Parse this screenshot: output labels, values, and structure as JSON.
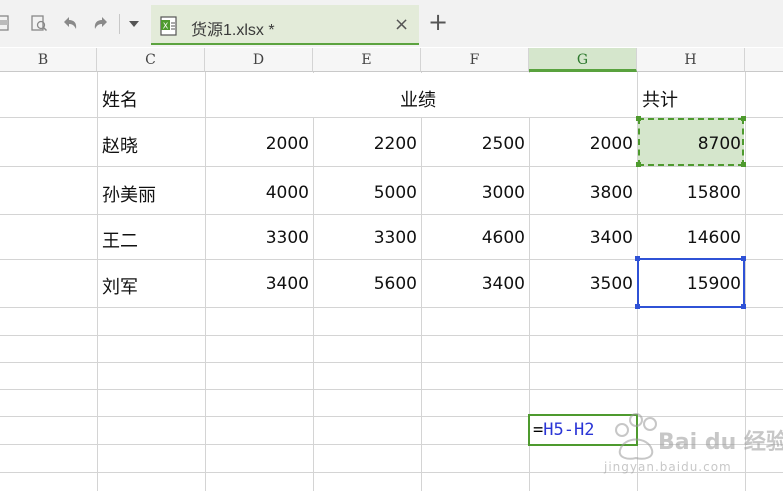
{
  "toolbar": {
    "icons": [
      "print-preview-icon",
      "print-icon",
      "undo-icon",
      "redo-icon",
      "dropdown-arrow-icon"
    ]
  },
  "tab": {
    "title": "货源1.xlsx *",
    "close_glyph": "×",
    "new_tab_glyph": "+"
  },
  "columns": [
    "B",
    "C",
    "D",
    "E",
    "F",
    "G",
    "H"
  ],
  "selected_column": "G",
  "table": {
    "header_name": "姓名",
    "header_performance": "业绩",
    "header_total": "共计",
    "rows": [
      {
        "name": "赵晓",
        "values": [
          "2000",
          "2200",
          "2500",
          "2000"
        ],
        "total": "8700"
      },
      {
        "name": "孙美丽",
        "values": [
          "4000",
          "5000",
          "3000",
          "3800"
        ],
        "total": "15800"
      },
      {
        "name": "王二",
        "values": [
          "3300",
          "3300",
          "4600",
          "3400"
        ],
        "total": "14600"
      },
      {
        "name": "刘军",
        "values": [
          "3400",
          "5600",
          "3400",
          "3500"
        ],
        "total": "15900"
      }
    ]
  },
  "formula": {
    "eq": "=",
    "ref_text": "H5-H2"
  },
  "watermark": {
    "brand": "Bai du 经验",
    "url": "jingyan.baidu.com"
  },
  "colors": {
    "selection_green": "#4e9a2e",
    "selection_fill": "#d5e6cc",
    "active_blue": "#2f52d6",
    "reference_blue": "#2a35d6"
  }
}
